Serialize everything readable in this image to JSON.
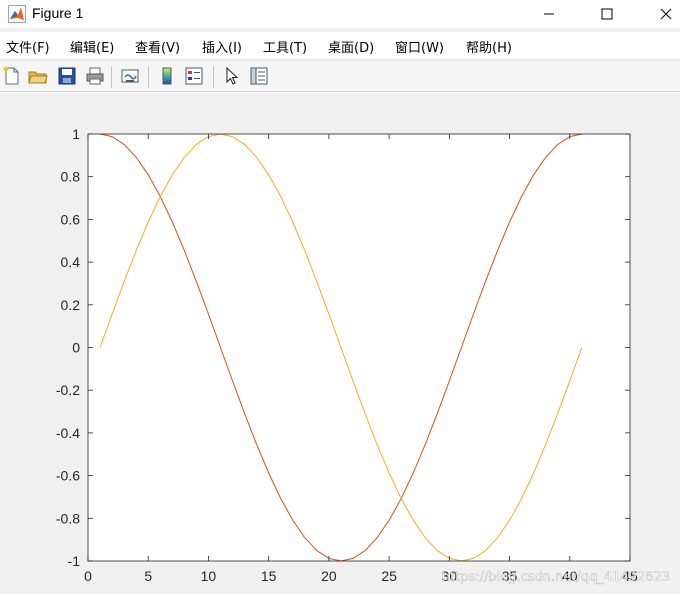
{
  "window": {
    "title": "Figure 1",
    "icon": "matlab-logo-icon"
  },
  "menu": [
    {
      "label": "文件(F)"
    },
    {
      "label": "编辑(E)"
    },
    {
      "label": "查看(V)"
    },
    {
      "label": "插入(I)"
    },
    {
      "label": "工具(T)"
    },
    {
      "label": "桌面(D)"
    },
    {
      "label": "窗口(W)"
    },
    {
      "label": "帮助(H)"
    }
  ],
  "toolbar": [
    {
      "icon": "new-figure-icon"
    },
    {
      "icon": "open-file-icon"
    },
    {
      "icon": "save-icon"
    },
    {
      "icon": "print-icon"
    },
    {
      "icon": "link-plot-icon"
    },
    {
      "icon": "insert-colorbar-icon"
    },
    {
      "icon": "insert-legend-icon"
    },
    {
      "icon": "edit-plot-arrow-icon"
    },
    {
      "icon": "property-inspector-icon"
    }
  ],
  "watermark": "https://blog.csdn.net/qq_41492623",
  "colors": {
    "series_cos": "#d95319",
    "series_sin": "#edb120"
  },
  "chart_data": {
    "type": "line",
    "xlim": [
      0,
      45
    ],
    "ylim": [
      -1,
      1
    ],
    "xticks": [
      0,
      5,
      10,
      15,
      20,
      25,
      30,
      35,
      40,
      45
    ],
    "yticks": [
      1,
      0.8,
      0.6,
      0.4,
      0.2,
      0,
      -0.2,
      -0.4,
      -0.6,
      -0.8,
      -1
    ],
    "xtick_labels": [
      "0",
      "5",
      "10",
      "15",
      "20",
      "25",
      "30",
      "35",
      "40",
      "45"
    ],
    "ytick_labels": [
      "1",
      "0.8",
      "0.6",
      "0.4",
      "0.2",
      "0",
      "-0.2",
      "-0.4",
      "-0.6",
      "-0.8",
      "-1"
    ],
    "grid": false,
    "x": [
      1,
      2,
      3,
      4,
      5,
      6,
      7,
      8,
      9,
      10,
      11,
      12,
      13,
      14,
      15,
      16,
      17,
      18,
      19,
      20,
      21,
      22,
      23,
      24,
      25,
      26,
      27,
      28,
      29,
      30,
      31,
      32,
      33,
      34,
      35,
      36,
      37,
      38,
      39,
      40,
      41
    ],
    "series": [
      {
        "color": "#d95319",
        "values": [
          1.0,
          0.9877,
          0.9511,
          0.891,
          0.809,
          0.7071,
          0.5878,
          0.454,
          0.309,
          0.1564,
          0.0,
          -0.1564,
          -0.309,
          -0.454,
          -0.5878,
          -0.7071,
          -0.809,
          -0.891,
          -0.9511,
          -0.9877,
          -1.0,
          -0.9877,
          -0.9511,
          -0.891,
          -0.809,
          -0.7071,
          -0.5878,
          -0.454,
          -0.309,
          -0.1564,
          0.0,
          0.1564,
          0.309,
          0.454,
          0.5878,
          0.7071,
          0.809,
          0.891,
          0.9511,
          0.9877,
          1.0
        ]
      },
      {
        "color": "#edb120",
        "values": [
          0.0,
          0.1564,
          0.309,
          0.454,
          0.5878,
          0.7071,
          0.809,
          0.891,
          0.9511,
          0.9877,
          1.0,
          0.9877,
          0.9511,
          0.891,
          0.809,
          0.7071,
          0.5878,
          0.454,
          0.309,
          0.1564,
          0.0,
          -0.1564,
          -0.309,
          -0.454,
          -0.5878,
          -0.7071,
          -0.809,
          -0.891,
          -0.9511,
          -0.9877,
          -1.0,
          -0.9877,
          -0.9511,
          -0.891,
          -0.809,
          -0.7071,
          -0.5878,
          -0.454,
          -0.309,
          -0.1564,
          0.0
        ]
      }
    ]
  }
}
